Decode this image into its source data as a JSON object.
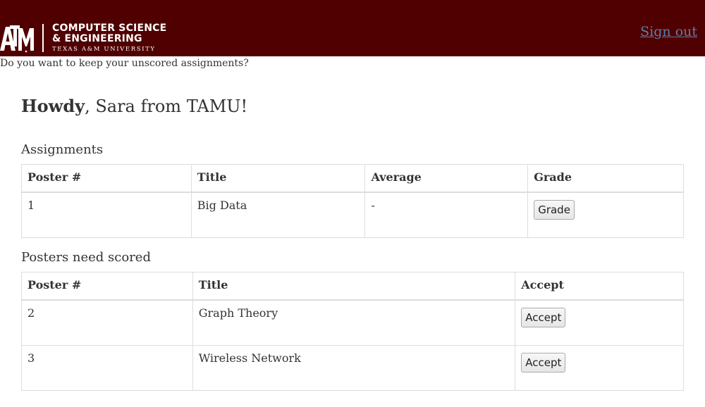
{
  "header": {
    "logo_line1": "COMPUTER SCIENCE",
    "logo_line2": "& ENGINEERING",
    "logo_line3": "TEXAS A&M UNIVERSITY",
    "signout_label": "Sign out",
    "brand_color": "#500000"
  },
  "notice": "Do you want to keep your unscored assignments?",
  "greeting": {
    "bold": "Howdy",
    "rest": ", Sara from TAMU!"
  },
  "assignments": {
    "title": "Assignments",
    "columns": [
      "Poster #",
      "Title",
      "Average",
      "Grade"
    ],
    "rows": [
      {
        "poster": "1",
        "title": "Big Data",
        "average": "-",
        "action": "Grade"
      }
    ]
  },
  "posters": {
    "title": "Posters need scored",
    "columns": [
      "Poster #",
      "Title",
      "Accept"
    ],
    "rows": [
      {
        "poster": "2",
        "title": "Graph Theory",
        "action": "Accept"
      },
      {
        "poster": "3",
        "title": "Wireless Network",
        "action": "Accept"
      }
    ]
  }
}
